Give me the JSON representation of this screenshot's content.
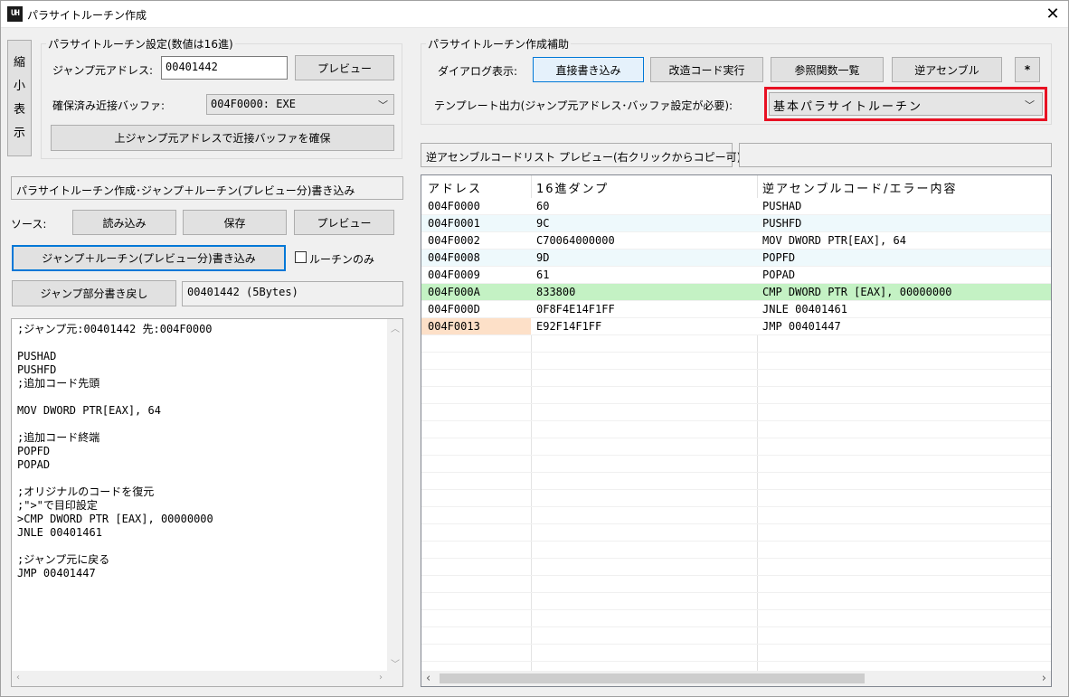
{
  "window": {
    "title": "パラサイトルーチン作成",
    "icon_text": "UH",
    "close": "✕"
  },
  "shrink_button": [
    "縮",
    "小",
    "表",
    "示"
  ],
  "settings": {
    "group_label": "パラサイトルーチン設定(数値は16進)",
    "jump_label": "ジャンプ元アドレス:",
    "jump_value": "00401442",
    "preview_button": "プレビュー",
    "buffer_label": "確保済み近接バッファ:",
    "buffer_value": "004F0000: EXE",
    "allocate_button": "上ジャンプ元アドレスで近接バッファを確保"
  },
  "assist": {
    "group_label": "パラサイトルーチン作成補助",
    "dialog_label": "ダイアログ表示:",
    "buttons": [
      "直接書き込み",
      "改造コード実行",
      "参照関数一覧",
      "逆アセンブル",
      "*"
    ],
    "template_label": "テンプレート出力(ジャンプ元アドレス･バッファ設定が必要):",
    "template_value": "基本パラサイトルーチン"
  },
  "write": {
    "header": "パラサイトルーチン作成･ジャンプ＋ルーチン(プレビュー分)書き込み",
    "source_label": "ソース:",
    "read_button": "読み込み",
    "save_button": "保存",
    "preview_button": "プレビュー",
    "write_button": "ジャンプ＋ルーチン(プレビュー分)書き込み",
    "routine_only": "ルーチンのみ",
    "restore_button": "ジャンプ部分書き戻し",
    "restore_info": "00401442 (5Bytes)"
  },
  "code": ";ジャンプ元:00401442 先:004F0000\n\nPUSHAD\nPUSHFD\n;追加コード先頭\n\nMOV DWORD PTR[EAX], 64\n\n;追加コード終端\nPOPFD\nPOPAD\n\n;オリジナルのコードを復元\n;\">\"で目印設定\n>CMP DWORD PTR [EAX], 00000000\nJNLE 00401461\n\n;ジャンプ元に戻る\nJMP 00401447",
  "disasm": {
    "header": "逆アセンブルコードリスト プレビュー(右クリックからコピー可)",
    "columns": [
      "アドレス",
      "16進ダンプ",
      "逆アセンブルコード/エラー内容"
    ],
    "rows": [
      [
        "004F0000",
        "60",
        "PUSHAD"
      ],
      [
        "004F0001",
        "9C",
        "PUSHFD"
      ],
      [
        "004F0002",
        "C70064000000",
        "MOV DWORD PTR[EAX], 64"
      ],
      [
        "004F0008",
        "9D",
        "POPFD"
      ],
      [
        "004F0009",
        "61",
        "POPAD"
      ],
      [
        "004F000A",
        "833800",
        "CMP DWORD PTR [EAX], 00000000"
      ],
      [
        "004F000D",
        "0F8F4E14F1FF",
        "JNLE 00401461"
      ],
      [
        "004F0013",
        "E92F14F1FF",
        "JMP 00401447"
      ]
    ],
    "row_colors": [
      "#ffffff",
      "#eef9fc",
      "#ffffff",
      "#eef9fc",
      "#ffffff",
      "#c4f2c4",
      "#ffffff",
      "#ffffff"
    ],
    "highlight_cell_color": "#fde0c8"
  }
}
